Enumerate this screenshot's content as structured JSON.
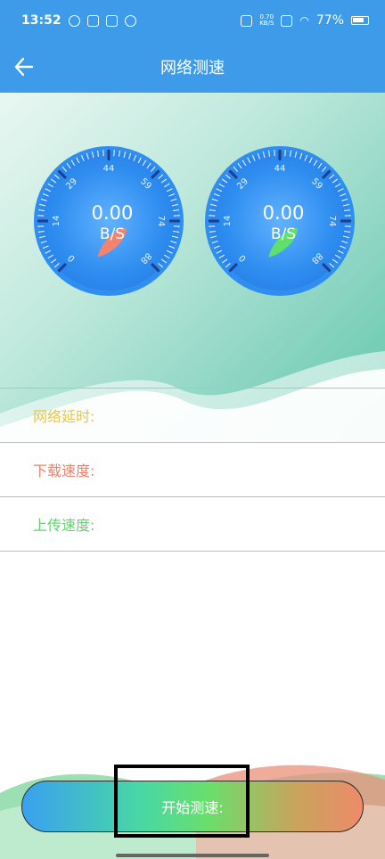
{
  "status_bar": {
    "time": "13:52",
    "net_speed_value": "0.70",
    "net_speed_unit": "KB/S",
    "battery": "77%",
    "icons": [
      "vpn-icon",
      "calendar-icon",
      "taobao-icon",
      "fan-icon",
      "vibrate-icon",
      "sim-icon",
      "wifi-icon",
      "battery-icon"
    ]
  },
  "app_bar": {
    "title": "网络测速",
    "back_icon": "arrow-left-icon"
  },
  "gauges": [
    {
      "value_text": "0.00",
      "unit_text": "B/S",
      "ticks": [
        "0",
        "14",
        "29",
        "44",
        "59",
        "74",
        "88"
      ],
      "needle_color": "#f2846e",
      "value": 0
    },
    {
      "value_text": "0.00",
      "unit_text": "B/S",
      "ticks": [
        "0",
        "14",
        "29",
        "44",
        "59",
        "74",
        "88"
      ],
      "needle_color": "#5fe06a",
      "value": 0
    }
  ],
  "rows": [
    {
      "label": "网络延时:",
      "color": "#e7c54c"
    },
    {
      "label": "下载速度:",
      "color": "#e8826c"
    },
    {
      "label": "上传速度:",
      "color": "#5dd46a"
    }
  ],
  "start_button": {
    "label": "开始测速:"
  },
  "colors": {
    "primary": "#3d9be9"
  }
}
